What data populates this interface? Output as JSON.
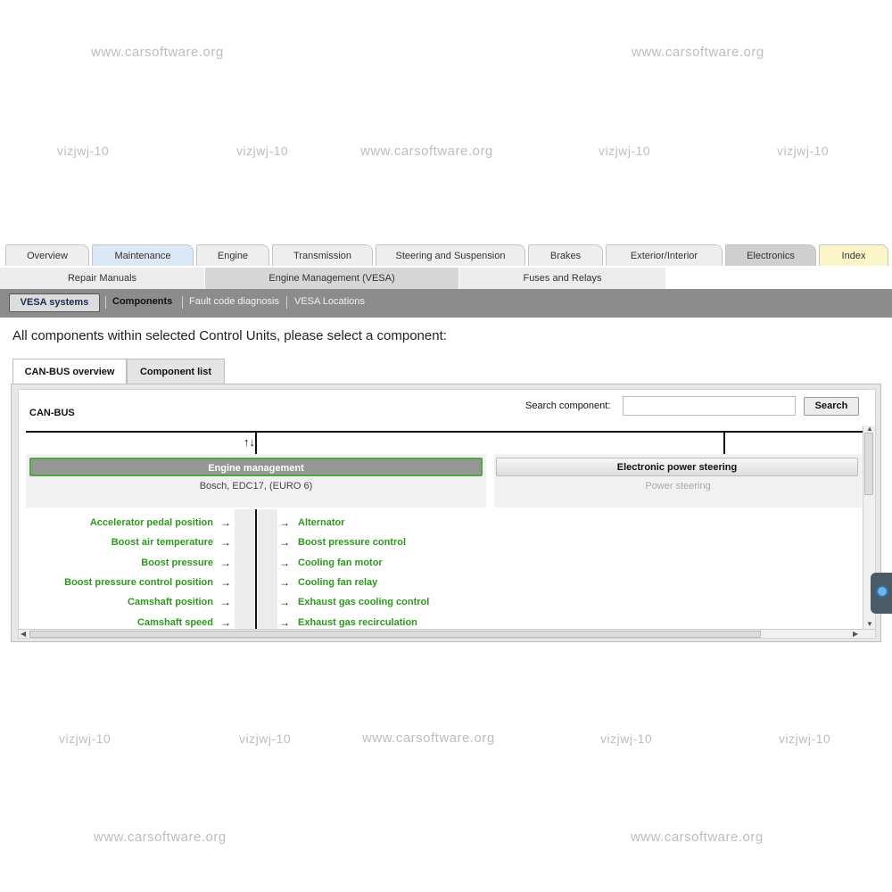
{
  "watermarks": {
    "site": "www.carsoftware.org",
    "code": "vizjwj-10"
  },
  "top_tabs": [
    "Overview",
    "Maintenance",
    "Engine",
    "Transmission",
    "Steering and Suspension",
    "Brakes",
    "Exterior/Interior",
    "Electronics",
    "Index"
  ],
  "sub_tabs": [
    "Repair Manuals",
    "Engine Management (VESA)",
    "Fuses and Relays"
  ],
  "toolbar": {
    "vesa_systems": "VESA systems",
    "components": "Components",
    "fault_code": "Fault code diagnosis",
    "vesa_locations": "VESA Locations"
  },
  "heading": "All components within selected Control Units, please select a component:",
  "inner_tabs": [
    "CAN-BUS overview",
    "Component list"
  ],
  "panel": {
    "canbus_label": "CAN-BUS",
    "search_label": "Search component:",
    "search_value": "",
    "search_button": "Search",
    "bus_arrows": "↑↓"
  },
  "control_units": [
    {
      "title": "Engine management",
      "subtitle": "Bosch, EDC17, (EURO 6)",
      "selected": true
    },
    {
      "title": "Electronic power steering",
      "subtitle": "Power steering",
      "selected": false
    }
  ],
  "inputs_list": [
    "Accelerator pedal position",
    "Boost air temperature",
    "Boost pressure",
    "Boost pressure control position",
    "Camshaft position",
    "Camshaft speed"
  ],
  "outputs_list": [
    "Alternator",
    "Boost pressure control",
    "Cooling fan motor",
    "Cooling fan relay",
    "Exhaust gas cooling control",
    "Exhaust gas recirculation"
  ],
  "arrow_glyph": "→",
  "colors": {
    "component_green": "#2a9a1a",
    "selected_border": "#4caa3c",
    "toolbar_grey": "#8c8c8c"
  }
}
